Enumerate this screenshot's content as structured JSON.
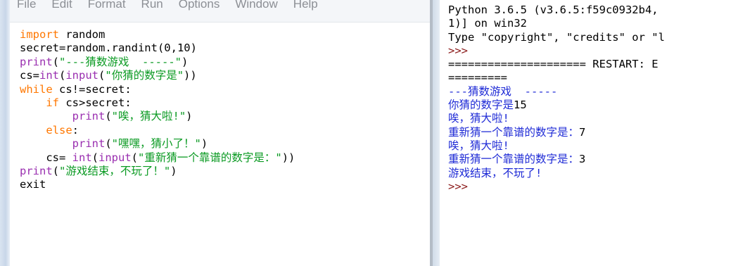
{
  "editor": {
    "menu": [
      "File",
      "Edit",
      "Format",
      "Run",
      "Options",
      "Window",
      "Help"
    ],
    "code": [
      [
        {
          "t": "import",
          "c": "kw"
        },
        {
          "t": " random",
          "c": "pl"
        }
      ],
      [
        {
          "t": "secret=random.randint(0,10)",
          "c": "pl"
        }
      ],
      [
        {
          "t": "print",
          "c": "bi"
        },
        {
          "t": "(",
          "c": "pl"
        },
        {
          "t": "\"---猜数游戏  -----\"",
          "c": "str"
        },
        {
          "t": ")",
          "c": "pl"
        }
      ],
      [
        {
          "t": "cs=",
          "c": "pl"
        },
        {
          "t": "int",
          "c": "bi"
        },
        {
          "t": "(",
          "c": "pl"
        },
        {
          "t": "input",
          "c": "bi"
        },
        {
          "t": "(",
          "c": "pl"
        },
        {
          "t": "\"你猜的数字是\"",
          "c": "str"
        },
        {
          "t": "))",
          "c": "pl"
        }
      ],
      [
        {
          "t": "while",
          "c": "kw"
        },
        {
          "t": " cs!=secret:",
          "c": "pl"
        }
      ],
      [
        {
          "t": "    ",
          "c": "pl"
        },
        {
          "t": "if",
          "c": "kw"
        },
        {
          "t": " cs>secret:",
          "c": "pl"
        }
      ],
      [
        {
          "t": "        ",
          "c": "pl"
        },
        {
          "t": "print",
          "c": "bi"
        },
        {
          "t": "(",
          "c": "pl"
        },
        {
          "t": "\"唉，猜大啦!\"",
          "c": "str"
        },
        {
          "t": ")",
          "c": "pl"
        }
      ],
      [
        {
          "t": "    ",
          "c": "pl"
        },
        {
          "t": "else",
          "c": "kw"
        },
        {
          "t": ":",
          "c": "pl"
        }
      ],
      [
        {
          "t": "        ",
          "c": "pl"
        },
        {
          "t": "print",
          "c": "bi"
        },
        {
          "t": "(",
          "c": "pl"
        },
        {
          "t": "\"嘿嘿，猜小了！\"",
          "c": "str"
        },
        {
          "t": ")",
          "c": "pl"
        }
      ],
      [
        {
          "t": "    cs= ",
          "c": "pl"
        },
        {
          "t": "int",
          "c": "bi"
        },
        {
          "t": "(",
          "c": "pl"
        },
        {
          "t": "input",
          "c": "bi"
        },
        {
          "t": "(",
          "c": "pl"
        },
        {
          "t": "\"重新猜一个靠谱的数字是：\"",
          "c": "str"
        },
        {
          "t": "))",
          "c": "pl"
        }
      ],
      [
        {
          "t": "print",
          "c": "bi"
        },
        {
          "t": "(",
          "c": "pl"
        },
        {
          "t": "\"游戏结束，不玩了！\"",
          "c": "str"
        },
        {
          "t": ")",
          "c": "pl"
        }
      ],
      [
        {
          "t": "exit",
          "c": "pl"
        }
      ]
    ]
  },
  "shell": {
    "lines": [
      [
        {
          "t": "Python 3.6.5 (v3.6.5:f59c0932b4,",
          "c": "pl"
        }
      ],
      [
        {
          "t": "1)] on win32",
          "c": "pl"
        }
      ],
      [
        {
          "t": "Type \"copyright\", \"credits\" or \"l",
          "c": "pl"
        }
      ],
      [
        {
          "t": ">>>",
          "c": "prompt"
        }
      ],
      [
        {
          "t": "===================== RESTART: E",
          "c": "pl"
        }
      ],
      [
        {
          "t": "=========",
          "c": "pl"
        }
      ],
      [
        {
          "t": "---猜数游戏  -----",
          "c": "out"
        }
      ],
      [
        {
          "t": "你猜的数字是",
          "c": "out"
        },
        {
          "t": "15",
          "c": "pl"
        }
      ],
      [
        {
          "t": "唉，猜大啦!",
          "c": "out"
        }
      ],
      [
        {
          "t": "重新猜一个靠谱的数字是：",
          "c": "out"
        },
        {
          "t": "7",
          "c": "pl"
        }
      ],
      [
        {
          "t": "唉，猜大啦!",
          "c": "out"
        }
      ],
      [
        {
          "t": "重新猜一个靠谱的数字是：",
          "c": "out"
        },
        {
          "t": "3",
          "c": "pl"
        }
      ],
      [
        {
          "t": "游戏结束，不玩了!",
          "c": "out"
        }
      ],
      [
        {
          "t": ">>>",
          "c": "prompt"
        }
      ]
    ]
  },
  "colors": {
    "keyword": "#ff7700",
    "builtin": "#9a2fb0",
    "string": "#0a9a22",
    "shell_output": "#1f2bd6",
    "prompt": "#8b1a1a"
  }
}
